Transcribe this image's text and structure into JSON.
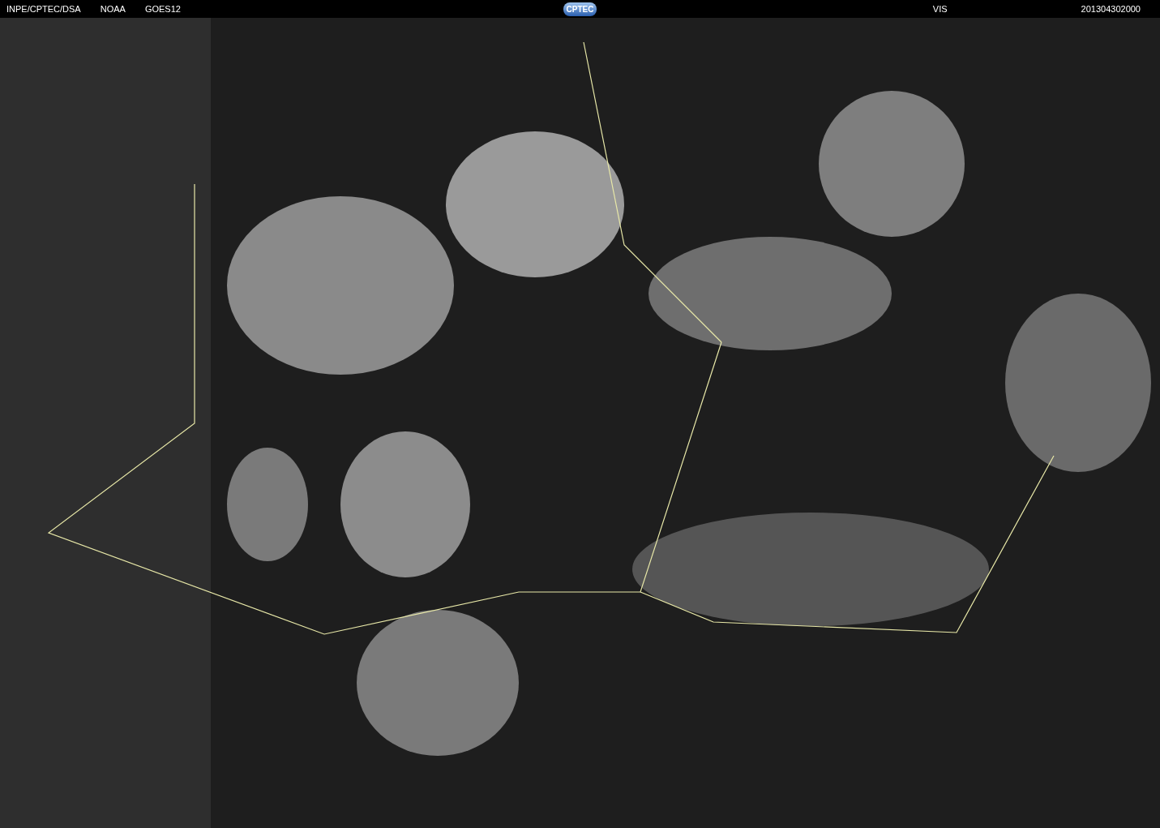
{
  "header": {
    "left": [
      "INPE/CPTEC/DSA",
      "NOAA",
      "GOES12"
    ],
    "logo": "CPTEC",
    "channel": "VIS",
    "timestamp": "201304302000"
  }
}
